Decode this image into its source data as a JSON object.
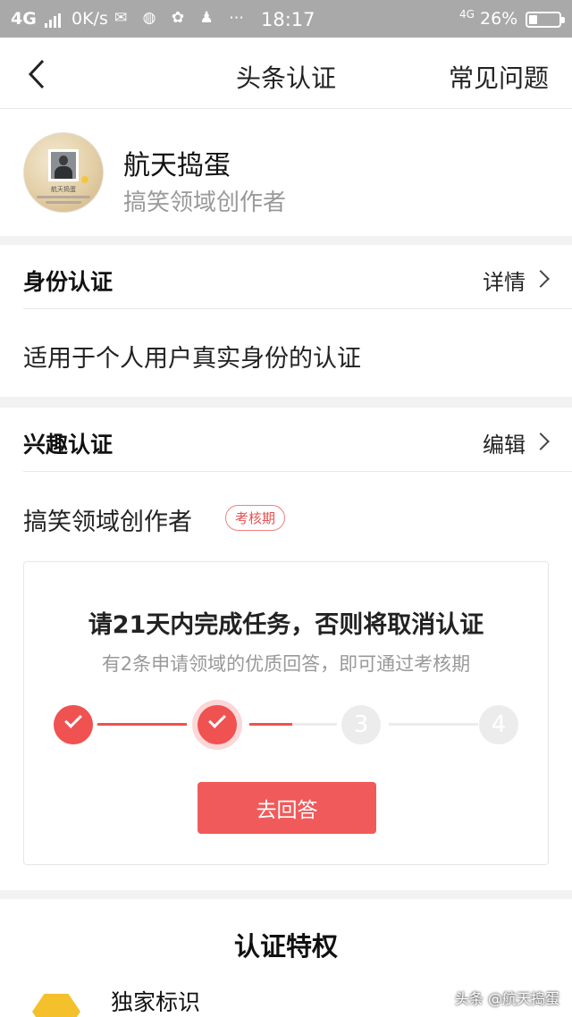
{
  "status_bar": {
    "network": "4G",
    "speed": "0K/s",
    "time": "18:17",
    "network_small": "4G",
    "battery": "26%"
  },
  "nav": {
    "title": "头条认证",
    "faq": "常见问题"
  },
  "profile": {
    "name": "航天捣蛋",
    "subtitle": "搞笑领域创作者",
    "avatar_caption": "航天捣蛋"
  },
  "identity": {
    "header": "身份认证",
    "action": "详情",
    "description": "适用于个人用户真实身份的认证"
  },
  "interest": {
    "header": "兴趣认证",
    "action": "编辑",
    "field": "搞笑领域创作者",
    "badge": "考核期"
  },
  "task": {
    "title": "请21天内完成任务，否则将取消认证",
    "subtitle": "有2条申请领域的优质回答，即可通过考核期",
    "steps": [
      "",
      "",
      "3",
      "4"
    ],
    "completed_steps": 2,
    "button": "去回答"
  },
  "privileges": {
    "title": "认证特权",
    "items": [
      "独家标识"
    ]
  },
  "watermark": "头条 @航天捣蛋",
  "colors": {
    "accent": "#f05151",
    "badge": "#e85050"
  }
}
